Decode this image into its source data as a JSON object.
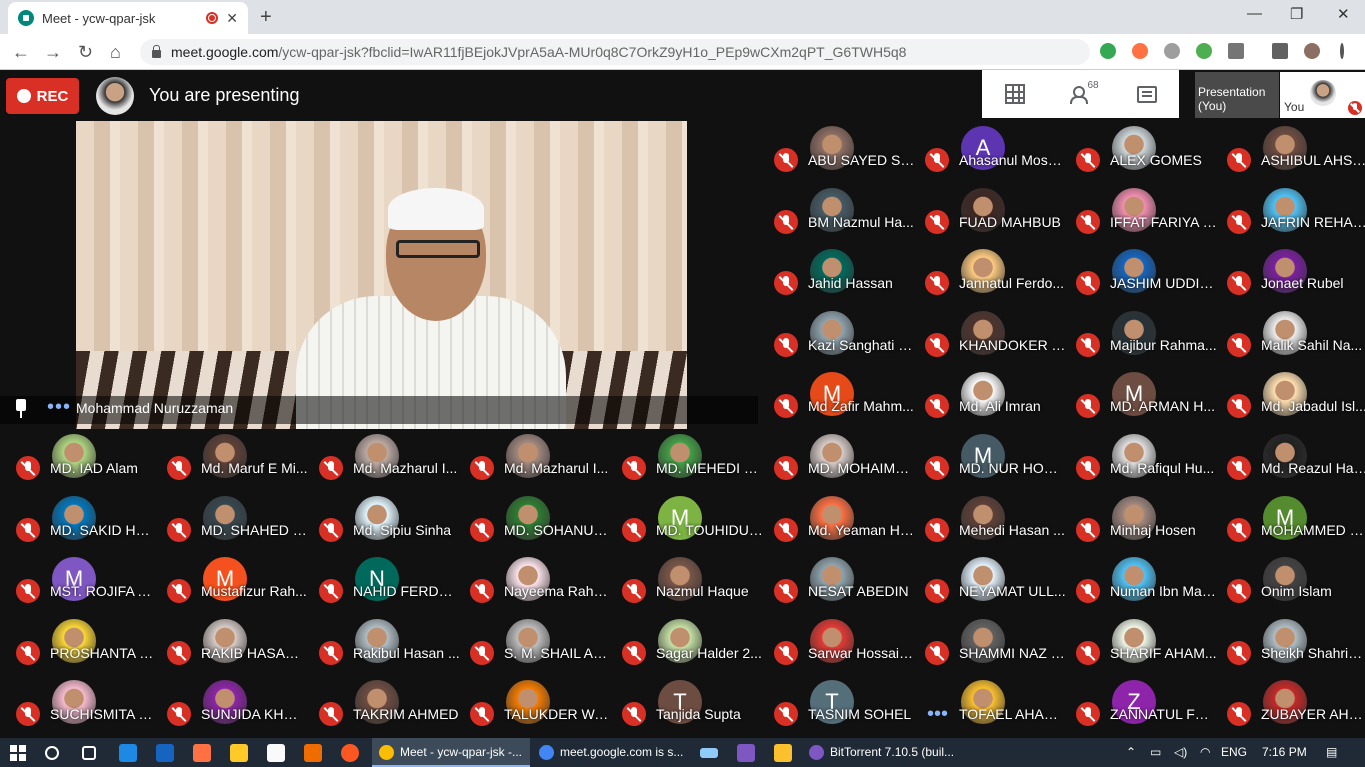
{
  "browser": {
    "tab_title": "Meet - ycw-qpar-jsk",
    "tab_close": "✕",
    "new_tab": "+",
    "url_domain": "meet.google.com",
    "url_rest": "/ycw-qpar-jsk?fbclid=IwAR11fjBEjokJVprA5aA-MUr0q8C7OrkZ9yH1o_PEp9wCXm2qPT_G6TWH5q8",
    "window": {
      "minimize": "—",
      "restore": "❐",
      "close": "✕"
    },
    "nav": {
      "back": "←",
      "forward": "→",
      "reload": "↻",
      "home": "⌂"
    }
  },
  "meet": {
    "rec_label": "REC",
    "presenting_text": "You are presenting",
    "people_count": "68",
    "presentation_tile": "Presentation (You)",
    "you_label": "You",
    "main_speaker": "Mohammad Nuruzzaman",
    "accent": "#d93025"
  },
  "participants": [
    {
      "name": "ABU SAYED SH...",
      "av": "photo",
      "color": "#8d6e63"
    },
    {
      "name": "Ahasanul Mosh...",
      "av": "A",
      "color": "#5e35b1"
    },
    {
      "name": "ALEX GOMES",
      "av": "photo",
      "color": "#cfd8dc"
    },
    {
      "name": "ASHIBUL AHSA...",
      "av": "photo",
      "color": "#6d4c41"
    },
    {
      "name": "BM Nazmul Ha...",
      "av": "photo",
      "color": "#455a64"
    },
    {
      "name": "FUAD MAHBUB",
      "av": "photo",
      "color": "#3e2723"
    },
    {
      "name": "IFFAT FARIYA M...",
      "av": "photo",
      "color": "#f48fb1"
    },
    {
      "name": "JAFRIN REHANA",
      "av": "photo",
      "color": "#4fc3f7"
    },
    {
      "name": "Jahid Hassan",
      "av": "photo",
      "color": "#00695c"
    },
    {
      "name": "Jannatul Ferdo...",
      "av": "photo",
      "color": "#ffcc80"
    },
    {
      "name": "JASHIM UDDIN...",
      "av": "photo",
      "color": "#1565c0"
    },
    {
      "name": "Jonaet Rubel",
      "av": "photo",
      "color": "#7b1fa2"
    },
    {
      "name": "Kazi Sanghati S...",
      "av": "photo",
      "color": "#90a4ae"
    },
    {
      "name": "KHANDOKER T...",
      "av": "photo",
      "color": "#4e342e"
    },
    {
      "name": "Majibur Rahma...",
      "av": "photo",
      "color": "#263238"
    },
    {
      "name": "Malik Sahil Na...",
      "av": "photo",
      "color": "#eeeeee"
    },
    {
      "name": "Md Zafir Mahm...",
      "av": "M",
      "color": "#e64a19"
    },
    {
      "name": "Md. Ali Imran",
      "av": "photo",
      "color": "#fafafa"
    },
    {
      "name": "MD. ARMAN H...",
      "av": "M",
      "color": "#6d4c41"
    },
    {
      "name": "Md. Jabadul Isl...",
      "av": "photo",
      "color": "#ffe0b2"
    },
    {
      "name": "MD. IAD Alam",
      "av": "photo",
      "color": "#aed581"
    },
    {
      "name": "Md. Maruf E Mi...",
      "av": "photo",
      "color": "#5d4037"
    },
    {
      "name": "Md. Mazharul I...",
      "av": "photo",
      "color": "#bcaaa4"
    },
    {
      "name": "Md. Mazharul I...",
      "av": "photo",
      "color": "#a1887f"
    },
    {
      "name": "MD. MEHEDI H...",
      "av": "photo",
      "color": "#43a047"
    },
    {
      "name": "MD. MOHAIME...",
      "av": "photo",
      "color": "#d7ccc8"
    },
    {
      "name": "MD. NUR HOSS...",
      "av": "M",
      "color": "#455a64"
    },
    {
      "name": "Md. Rafiqul Hu...",
      "av": "photo",
      "color": "#e0e0e0"
    },
    {
      "name": "Md. Reazul Has...",
      "av": "photo",
      "color": "#212121"
    },
    {
      "name": "MD. SAKID HAS...",
      "av": "photo",
      "color": "#0277bd"
    },
    {
      "name": "MD. SHAHED IS...",
      "av": "photo",
      "color": "#37474f"
    },
    {
      "name": "Md. Sipiu Sinha",
      "av": "photo",
      "color": "#e1f5fe"
    },
    {
      "name": "MD. SOHANUR ...",
      "av": "photo",
      "color": "#2e7d32"
    },
    {
      "name": "MD. TOUHIDUL ...",
      "av": "M",
      "color": "#7cb342"
    },
    {
      "name": "Md. Yeaman Ha...",
      "av": "photo",
      "color": "#ff7043"
    },
    {
      "name": "Mehedi Hasan ...",
      "av": "photo",
      "color": "#5d4037"
    },
    {
      "name": "Minhaj Hosen",
      "av": "photo",
      "color": "#a1887f"
    },
    {
      "name": "MOHAMMED E...",
      "av": "M",
      "color": "#558b2f"
    },
    {
      "name": "MST. ROJIFA A...",
      "av": "M",
      "color": "#7e57c2"
    },
    {
      "name": "Mustafizur Rah...",
      "av": "M",
      "color": "#f4511e"
    },
    {
      "name": "NAHID FERDOUS",
      "av": "N",
      "color": "#00695c"
    },
    {
      "name": "Nayeema Rahm...",
      "av": "photo",
      "color": "#fce4ec"
    },
    {
      "name": "Nazmul Haque",
      "av": "photo",
      "color": "#795548"
    },
    {
      "name": "NESAT ABEDIN",
      "av": "photo",
      "color": "#90a4ae"
    },
    {
      "name": "NEYAMAT ULL...",
      "av": "photo",
      "color": "#e3f2fd"
    },
    {
      "name": "Numan Ibn Maz...",
      "av": "photo",
      "color": "#4fc3f7"
    },
    {
      "name": "Onim Islam",
      "av": "photo",
      "color": "#424242"
    },
    {
      "name": "PROSHANTA M...",
      "av": "photo",
      "color": "#fdd835"
    },
    {
      "name": "RAKIB HASAN ...",
      "av": "photo",
      "color": "#d7ccc8"
    },
    {
      "name": "Rakibul Hasan ...",
      "av": "photo",
      "color": "#b0bec5"
    },
    {
      "name": "S. M. SHAIL AF...",
      "av": "photo",
      "color": "#bdbdbd"
    },
    {
      "name": "Sagar Halder 2...",
      "av": "photo",
      "color": "#c5e1a5"
    },
    {
      "name": "Sarwar Hossain...",
      "av": "photo",
      "color": "#e53935"
    },
    {
      "name": "SHAMMI NAZ S...",
      "av": "photo",
      "color": "#616161"
    },
    {
      "name": "SHARIF AHAM...",
      "av": "photo",
      "color": "#f1f8e9"
    },
    {
      "name": "Sheikh Shahriya...",
      "av": "photo",
      "color": "#b0bec5"
    },
    {
      "name": "SUCHISMITA R...",
      "av": "photo",
      "color": "#f8bbd0"
    },
    {
      "name": "SUNJIDA KHON...",
      "av": "photo",
      "color": "#8e24aa"
    },
    {
      "name": "TAKRIM AHMED",
      "av": "photo",
      "color": "#6d4c41"
    },
    {
      "name": "TALUKDER WA...",
      "av": "photo",
      "color": "#f57c00"
    },
    {
      "name": "Tanjida Supta",
      "av": "T",
      "color": "#6d4c41"
    },
    {
      "name": "TASNIM SOHEL",
      "av": "T",
      "color": "#546e7a"
    },
    {
      "name": "TOFAEL AHAM...",
      "av": "photo",
      "color": "#fbc02d",
      "dots": true
    },
    {
      "name": "ZANNATUL FER...",
      "av": "Z",
      "color": "#8e24aa"
    },
    {
      "name": "ZUBAYER AHM...",
      "av": "photo",
      "color": "#c62828"
    }
  ],
  "taskbar": {
    "apps": [
      {
        "label": "Meet - ycw-qpar-jsk -...",
        "color": "#fbbc04",
        "active": true
      },
      {
        "label": "meet.google.com is s...",
        "color": "#4285f4",
        "active": false
      },
      {
        "label": "BitTorrent 7.10.5  (buil...",
        "color": "#7e57c2",
        "active": false
      }
    ],
    "lang": "ENG",
    "time": "7:16 PM"
  }
}
